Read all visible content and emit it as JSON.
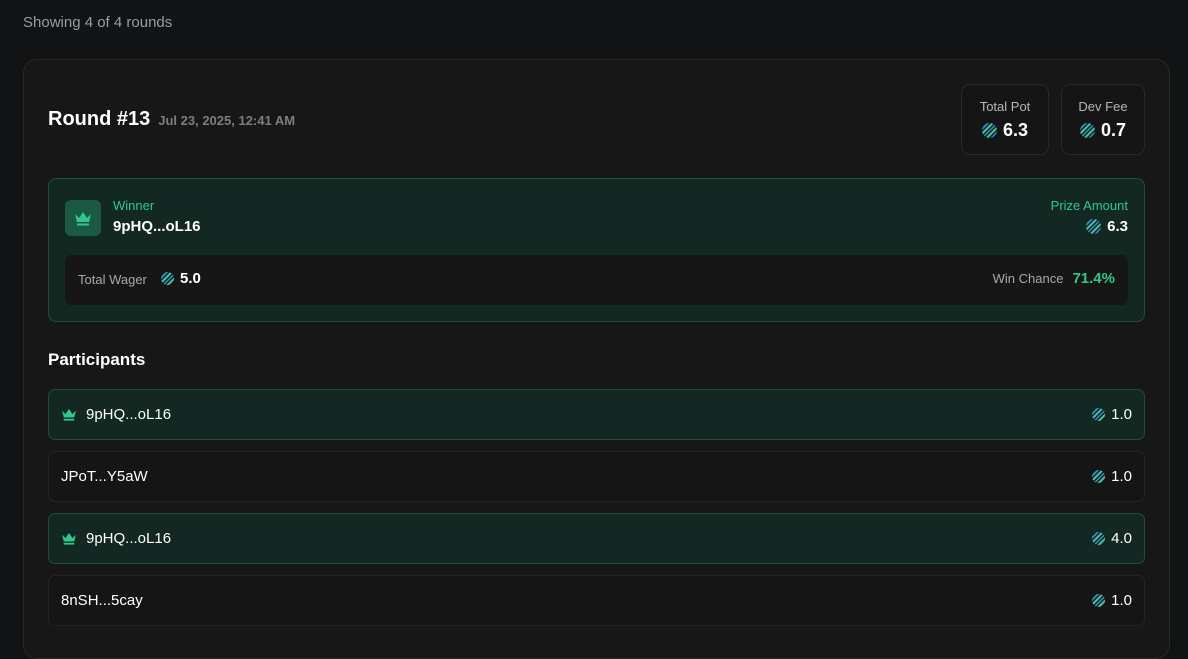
{
  "header": {
    "showing_text": "Showing 4 of 4 rounds"
  },
  "round": {
    "title": "Round #13",
    "date": "Jul 23, 2025, 12:41 AM",
    "total_pot_label": "Total Pot",
    "total_pot": "6.3",
    "dev_fee_label": "Dev Fee",
    "dev_fee": "0.7"
  },
  "winner": {
    "label": "Winner",
    "address": "9pHQ...oL16",
    "prize_label": "Prize Amount",
    "prize": "6.3",
    "total_wager_label": "Total Wager",
    "total_wager": "5.0",
    "win_chance_label": "Win Chance",
    "win_chance": "71.4%"
  },
  "participants": {
    "title": "Participants",
    "rows": [
      {
        "address": "9pHQ...oL16",
        "amount": "1.0",
        "is_winner": true
      },
      {
        "address": "JPoT...Y5aW",
        "amount": "1.0",
        "is_winner": false
      },
      {
        "address": "9pHQ...oL16",
        "amount": "4.0",
        "is_winner": true
      },
      {
        "address": "8nSH...5cay",
        "amount": "1.0",
        "is_winner": false
      }
    ]
  },
  "colors": {
    "accent": "#2ec98a",
    "background": "#111315",
    "card": "#171717",
    "winner_bg": "#132822"
  },
  "icons": {
    "crown": "crown-icon",
    "token": "token-icon"
  }
}
